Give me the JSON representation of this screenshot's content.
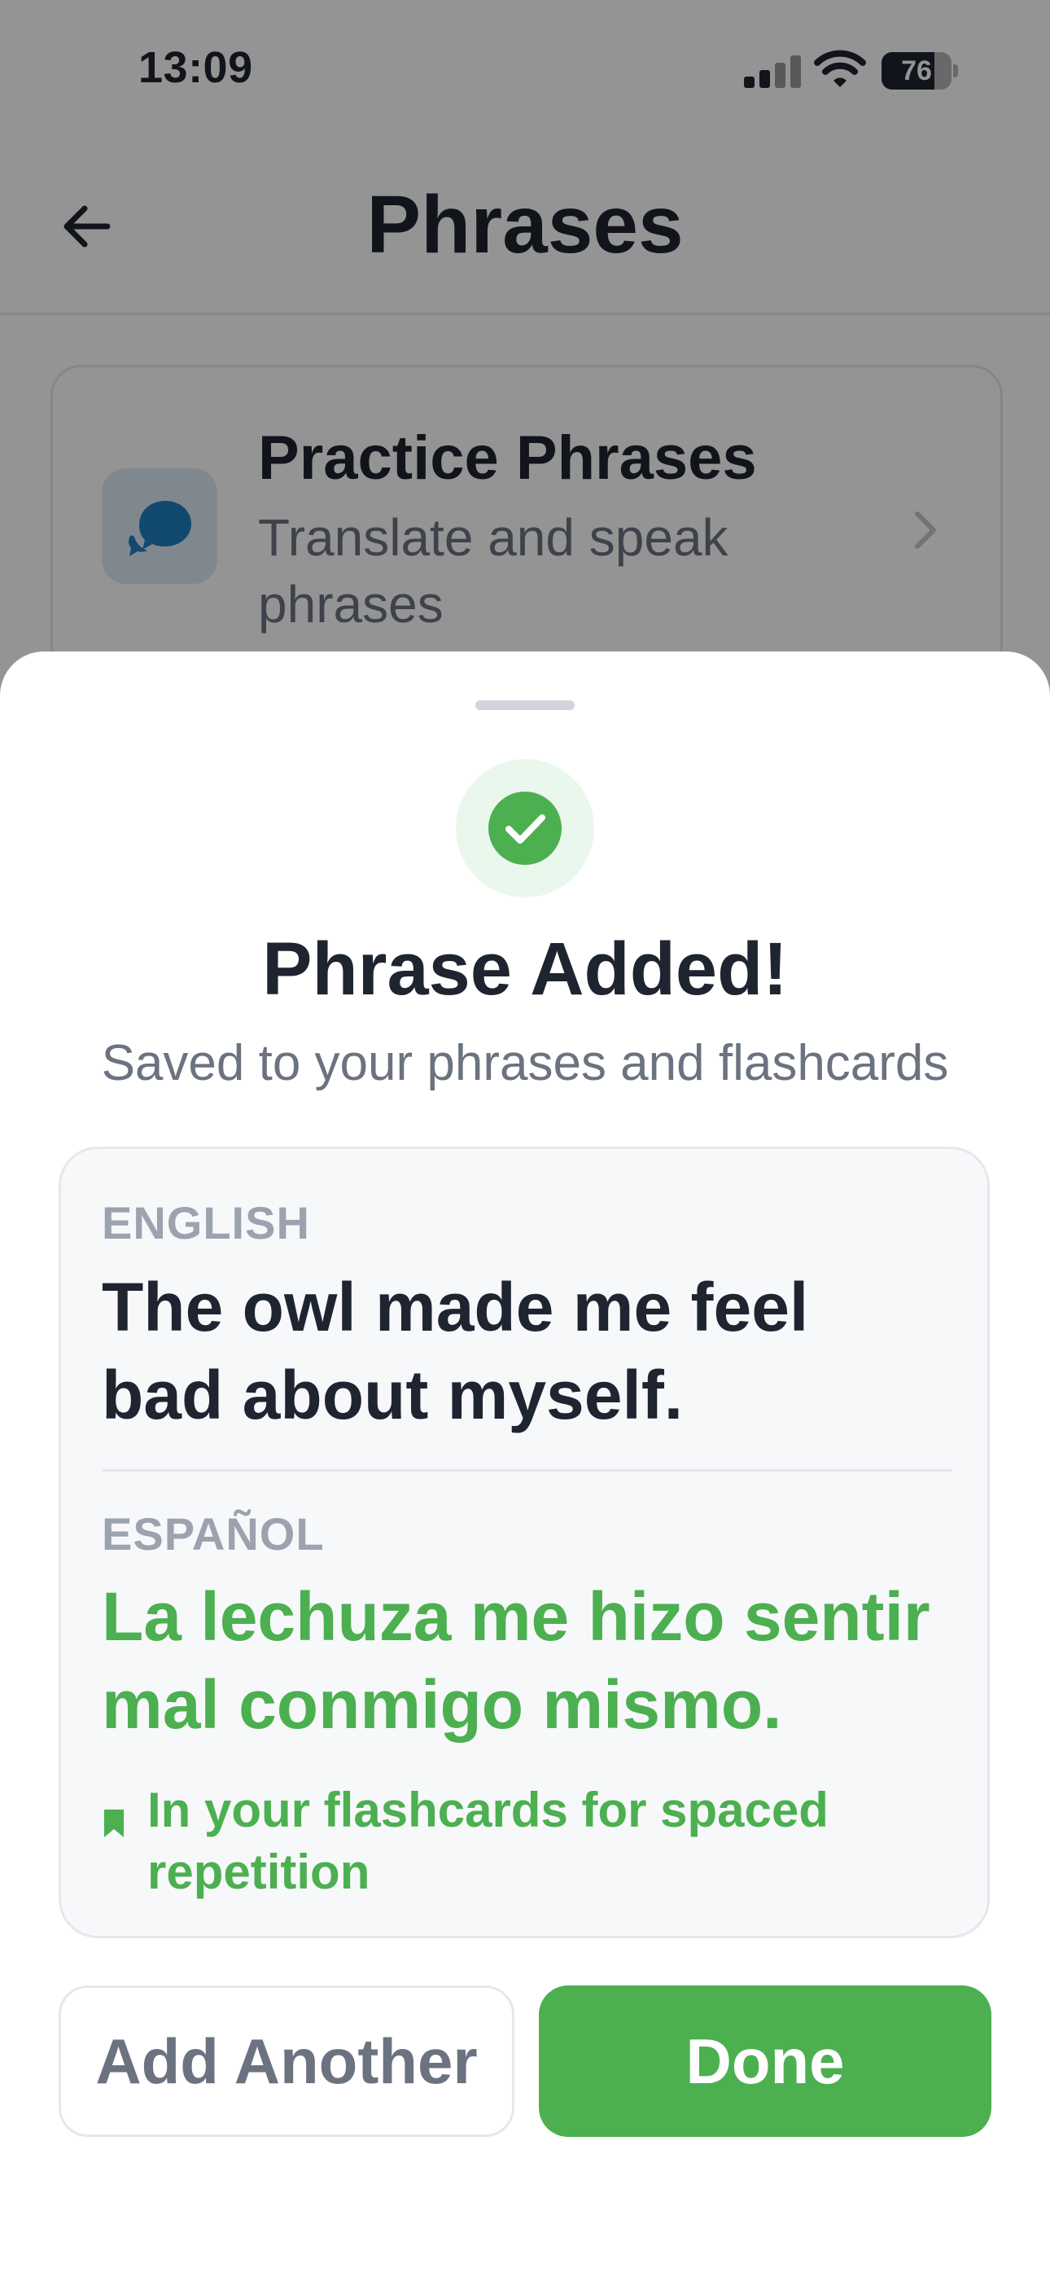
{
  "status_bar": {
    "time": "13:09",
    "battery": "76",
    "battery_level": 0.76
  },
  "nav": {
    "title": "Phrases",
    "back_icon": "arrow-left-icon"
  },
  "practice_card": {
    "title": "Practice Phrases",
    "subtitle": "Translate and speak phrases",
    "icon": "speech-bubbles-icon"
  },
  "sheet": {
    "success_icon": "check-circle-icon",
    "title": "Phrase Added!",
    "subtitle": "Saved to your phrases and flashcards",
    "card": {
      "english_label": "ENGLISH",
      "english_text": "The owl made me feel bad about myself.",
      "spanish_label": "ESPAÑOL",
      "spanish_text": "La lechuza me hizo sentir mal conmigo mismo.",
      "flashcard_note": "In your flashcards for spaced repetition",
      "flashcard_icon": "bookmark-icon"
    },
    "buttons": {
      "add_another": "Add Another",
      "done": "Done"
    }
  },
  "colors": {
    "accent_green": "#4caf50",
    "text_dark": "#1e2530",
    "text_muted": "#6b7280",
    "label_gray": "#9ca3af",
    "card_bg": "#f7f8fa",
    "practice_icon_bg": "#dcebf6",
    "practice_icon_fg": "#1f7fc0"
  }
}
